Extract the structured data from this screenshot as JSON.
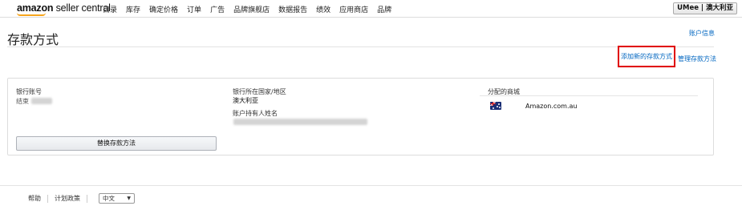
{
  "nav": {
    "logo_bold": "amazon",
    "logo_rest": " seller central",
    "items": [
      {
        "label": "目录"
      },
      {
        "label": "库存"
      },
      {
        "label": "确定价格"
      },
      {
        "label": "订单"
      },
      {
        "label": "广告"
      },
      {
        "label": "品牌旗舰店"
      },
      {
        "label": "数据报告"
      },
      {
        "label": "绩效"
      },
      {
        "label": "应用商店"
      },
      {
        "label": "品牌"
      }
    ],
    "account_button": "UMee | 澳大利亚"
  },
  "page": {
    "title": "存款方式",
    "account_info_link": "账户信息",
    "add_deposit_link": "添加新的存款方式",
    "manage_deposit_link": "管理存款方法"
  },
  "card": {
    "bank_account_label": "银行账号",
    "bank_account_prefix": "结束",
    "bank_country_label": "银行所在国家/地区",
    "bank_country_value": "澳大利亚",
    "holder_name_label": "账户持有人姓名",
    "assigned_marketplace_label": "分配的商城",
    "marketplace_name": "Amazon.com.au",
    "replace_button": "替换存款方法"
  },
  "footer": {
    "help": "帮助",
    "program_policies": "计划政策",
    "language": "中文"
  },
  "colors": {
    "link": "#0066c0",
    "highlight_border": "#e00000",
    "logo_smile": "#f7a51c"
  }
}
